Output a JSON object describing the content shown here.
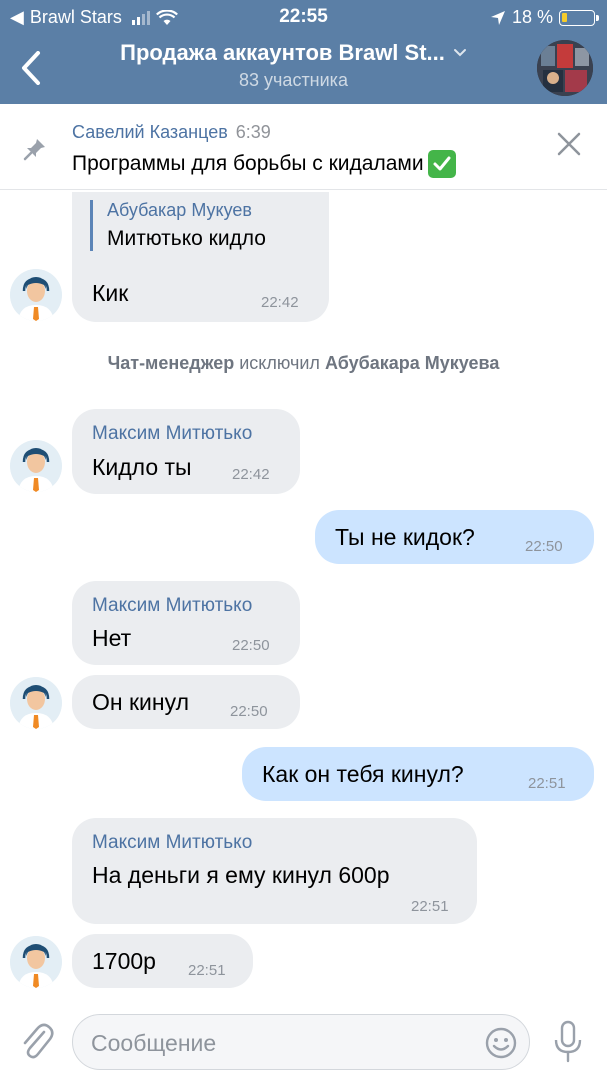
{
  "status_bar": {
    "carrier": "Brawl Stars",
    "time": "22:55",
    "battery": "18 %",
    "battery_level": 0.18
  },
  "header": {
    "title": "Продажа аккаунтов Brawl St...",
    "subtitle": "83 участника"
  },
  "pinned": {
    "author": "Савелий Казанцев",
    "time": "6:39",
    "text": "Программы для борьбы с кидалами"
  },
  "messages": [
    {
      "quote_author": "Абубакар Мукуев",
      "quote_text": "Митютько кидло",
      "text": "Кик",
      "time": "22:42"
    },
    {
      "service": {
        "actor": "Чат-менеджер",
        "action": "исключил",
        "target": "Абубакара Мукуева"
      }
    },
    {
      "author": "Максим Митютько",
      "text": "Кидло ты",
      "time": "22:42"
    },
    {
      "out": true,
      "text": "Ты не кидок?",
      "time": "22:50"
    },
    {
      "author": "Максим Митютько",
      "text": "Нет",
      "time": "22:50"
    },
    {
      "text": "Он кинул",
      "time": "22:50"
    },
    {
      "out": true,
      "text": "Как он тебя кинул?",
      "time": "22:51"
    },
    {
      "author": "Максим Митютько",
      "text": "На деньги я ему кинул 600р",
      "time": "22:51"
    },
    {
      "text": "1700р",
      "time": "22:51"
    }
  ],
  "input": {
    "placeholder": "Сообщение"
  },
  "colors": {
    "header": "#5b7fa6",
    "incoming_bubble": "#ebedf0",
    "outgoing_bubble": "#cce4ff",
    "link": "#4d73a3"
  }
}
